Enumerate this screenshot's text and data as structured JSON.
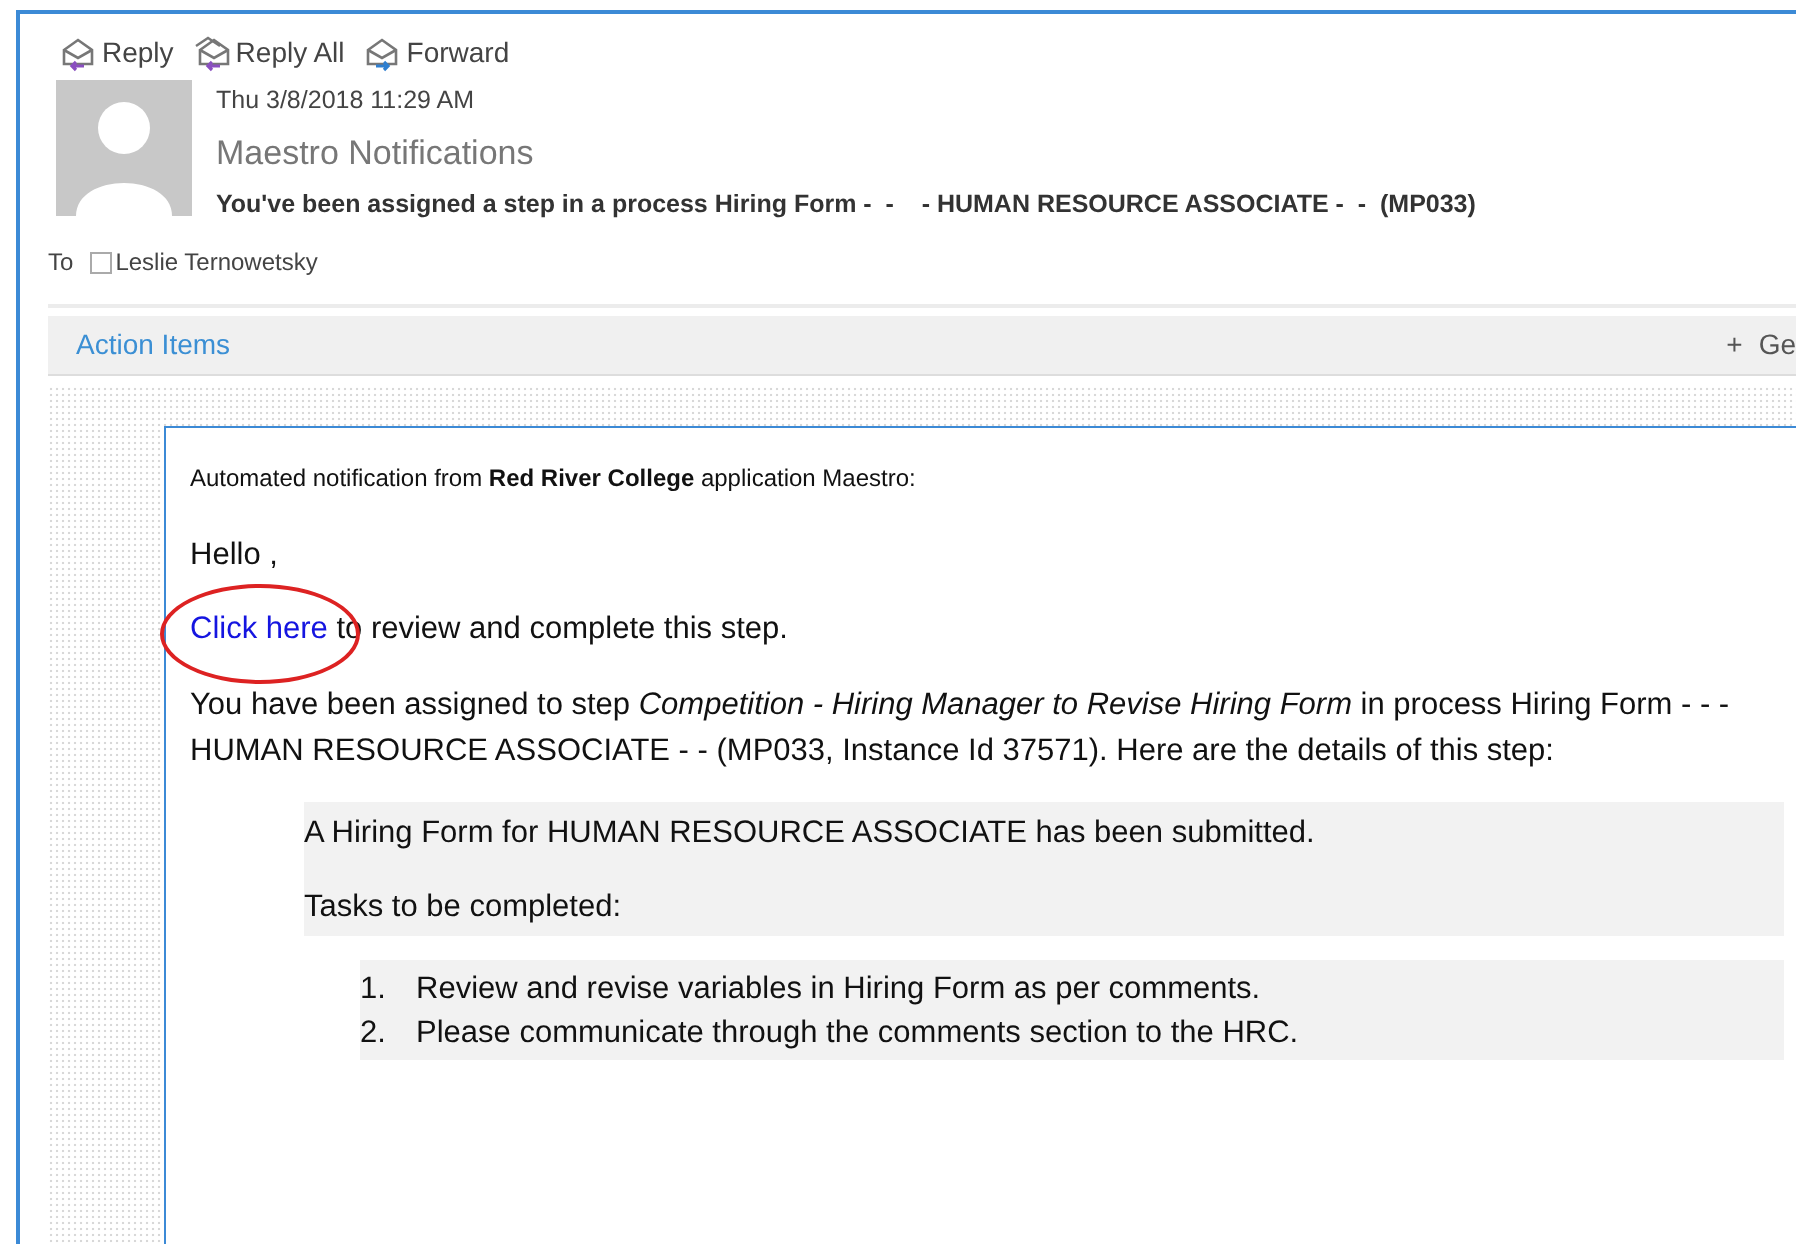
{
  "toolbar": [
    {
      "label": "Reply",
      "kind": "reply"
    },
    {
      "label": "Reply All",
      "kind": "replyall"
    },
    {
      "label": "Forward",
      "kind": "forward"
    }
  ],
  "header": {
    "date": "Thu 3/8/2018 11:29 AM",
    "sender": "Maestro Notifications",
    "subject": "You've been assigned a step in a process Hiring Form -  -    - HUMAN RESOURCE ASSOCIATE -  -  (MP033)",
    "to_label": "To",
    "recipient": "Leslie Ternowetsky"
  },
  "action_bar": {
    "title": "Action Items",
    "plus": "+",
    "right_text": "Ge"
  },
  "body": {
    "intro": "Automated notification from **Red River College** application Maestro:",
    "greeting": "Hello ,",
    "link": "Click here",
    "link_rest": "to review and complete this step.",
    "details": "You have been assigned to step *Competition - Hiring Manager to Revise Hiring Form* in process Hiring Form - - - HUMAN RESOURCE ASSOCIATE - - (MP033, Instance Id 37571). Here are the details of this step:",
    "block": [
      "A Hiring Form for HUMAN RESOURCE ASSOCIATE has been submitted.",
      "Tasks to be completed:"
    ],
    "tasks": [
      {
        "number": "1.",
        "text": "Review and revise variables in Hiring Form as per comments."
      },
      {
        "number": "2.",
        "text": "Please communicate through the comments section to the HRC."
      }
    ]
  }
}
